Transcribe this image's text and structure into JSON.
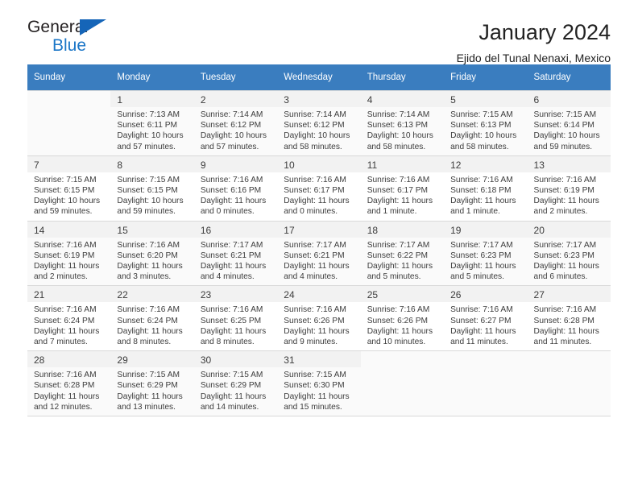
{
  "brand": {
    "name_dark": "General",
    "name_blue": "Blue",
    "accent_color": "#1b76c7",
    "triangle_color": "#1565b8"
  },
  "header": {
    "title": "January 2024",
    "subtitle": "Ejido del Tunal Nenaxi, Mexico"
  },
  "calendar": {
    "header_bg": "#3a7dbf",
    "header_text_color": "#ffffff",
    "weekdays": [
      "Sunday",
      "Monday",
      "Tuesday",
      "Wednesday",
      "Thursday",
      "Friday",
      "Saturday"
    ],
    "weeks": [
      [
        {
          "day": "",
          "lines": []
        },
        {
          "day": "1",
          "lines": [
            "Sunrise: 7:13 AM",
            "Sunset: 6:11 PM",
            "Daylight: 10 hours",
            "and 57 minutes."
          ]
        },
        {
          "day": "2",
          "lines": [
            "Sunrise: 7:14 AM",
            "Sunset: 6:12 PM",
            "Daylight: 10 hours",
            "and 57 minutes."
          ]
        },
        {
          "day": "3",
          "lines": [
            "Sunrise: 7:14 AM",
            "Sunset: 6:12 PM",
            "Daylight: 10 hours",
            "and 58 minutes."
          ]
        },
        {
          "day": "4",
          "lines": [
            "Sunrise: 7:14 AM",
            "Sunset: 6:13 PM",
            "Daylight: 10 hours",
            "and 58 minutes."
          ]
        },
        {
          "day": "5",
          "lines": [
            "Sunrise: 7:15 AM",
            "Sunset: 6:13 PM",
            "Daylight: 10 hours",
            "and 58 minutes."
          ]
        },
        {
          "day": "6",
          "lines": [
            "Sunrise: 7:15 AM",
            "Sunset: 6:14 PM",
            "Daylight: 10 hours",
            "and 59 minutes."
          ]
        }
      ],
      [
        {
          "day": "7",
          "lines": [
            "Sunrise: 7:15 AM",
            "Sunset: 6:15 PM",
            "Daylight: 10 hours",
            "and 59 minutes."
          ]
        },
        {
          "day": "8",
          "lines": [
            "Sunrise: 7:15 AM",
            "Sunset: 6:15 PM",
            "Daylight: 10 hours",
            "and 59 minutes."
          ]
        },
        {
          "day": "9",
          "lines": [
            "Sunrise: 7:16 AM",
            "Sunset: 6:16 PM",
            "Daylight: 11 hours",
            "and 0 minutes."
          ]
        },
        {
          "day": "10",
          "lines": [
            "Sunrise: 7:16 AM",
            "Sunset: 6:17 PM",
            "Daylight: 11 hours",
            "and 0 minutes."
          ]
        },
        {
          "day": "11",
          "lines": [
            "Sunrise: 7:16 AM",
            "Sunset: 6:17 PM",
            "Daylight: 11 hours",
            "and 1 minute."
          ]
        },
        {
          "day": "12",
          "lines": [
            "Sunrise: 7:16 AM",
            "Sunset: 6:18 PM",
            "Daylight: 11 hours",
            "and 1 minute."
          ]
        },
        {
          "day": "13",
          "lines": [
            "Sunrise: 7:16 AM",
            "Sunset: 6:19 PM",
            "Daylight: 11 hours",
            "and 2 minutes."
          ]
        }
      ],
      [
        {
          "day": "14",
          "lines": [
            "Sunrise: 7:16 AM",
            "Sunset: 6:19 PM",
            "Daylight: 11 hours",
            "and 2 minutes."
          ]
        },
        {
          "day": "15",
          "lines": [
            "Sunrise: 7:16 AM",
            "Sunset: 6:20 PM",
            "Daylight: 11 hours",
            "and 3 minutes."
          ]
        },
        {
          "day": "16",
          "lines": [
            "Sunrise: 7:17 AM",
            "Sunset: 6:21 PM",
            "Daylight: 11 hours",
            "and 4 minutes."
          ]
        },
        {
          "day": "17",
          "lines": [
            "Sunrise: 7:17 AM",
            "Sunset: 6:21 PM",
            "Daylight: 11 hours",
            "and 4 minutes."
          ]
        },
        {
          "day": "18",
          "lines": [
            "Sunrise: 7:17 AM",
            "Sunset: 6:22 PM",
            "Daylight: 11 hours",
            "and 5 minutes."
          ]
        },
        {
          "day": "19",
          "lines": [
            "Sunrise: 7:17 AM",
            "Sunset: 6:23 PM",
            "Daylight: 11 hours",
            "and 5 minutes."
          ]
        },
        {
          "day": "20",
          "lines": [
            "Sunrise: 7:17 AM",
            "Sunset: 6:23 PM",
            "Daylight: 11 hours",
            "and 6 minutes."
          ]
        }
      ],
      [
        {
          "day": "21",
          "lines": [
            "Sunrise: 7:16 AM",
            "Sunset: 6:24 PM",
            "Daylight: 11 hours",
            "and 7 minutes."
          ]
        },
        {
          "day": "22",
          "lines": [
            "Sunrise: 7:16 AM",
            "Sunset: 6:24 PM",
            "Daylight: 11 hours",
            "and 8 minutes."
          ]
        },
        {
          "day": "23",
          "lines": [
            "Sunrise: 7:16 AM",
            "Sunset: 6:25 PM",
            "Daylight: 11 hours",
            "and 8 minutes."
          ]
        },
        {
          "day": "24",
          "lines": [
            "Sunrise: 7:16 AM",
            "Sunset: 6:26 PM",
            "Daylight: 11 hours",
            "and 9 minutes."
          ]
        },
        {
          "day": "25",
          "lines": [
            "Sunrise: 7:16 AM",
            "Sunset: 6:26 PM",
            "Daylight: 11 hours",
            "and 10 minutes."
          ]
        },
        {
          "day": "26",
          "lines": [
            "Sunrise: 7:16 AM",
            "Sunset: 6:27 PM",
            "Daylight: 11 hours",
            "and 11 minutes."
          ]
        },
        {
          "day": "27",
          "lines": [
            "Sunrise: 7:16 AM",
            "Sunset: 6:28 PM",
            "Daylight: 11 hours",
            "and 11 minutes."
          ]
        }
      ],
      [
        {
          "day": "28",
          "lines": [
            "Sunrise: 7:16 AM",
            "Sunset: 6:28 PM",
            "Daylight: 11 hours",
            "and 12 minutes."
          ]
        },
        {
          "day": "29",
          "lines": [
            "Sunrise: 7:15 AM",
            "Sunset: 6:29 PM",
            "Daylight: 11 hours",
            "and 13 minutes."
          ]
        },
        {
          "day": "30",
          "lines": [
            "Sunrise: 7:15 AM",
            "Sunset: 6:29 PM",
            "Daylight: 11 hours",
            "and 14 minutes."
          ]
        },
        {
          "day": "31",
          "lines": [
            "Sunrise: 7:15 AM",
            "Sunset: 6:30 PM",
            "Daylight: 11 hours",
            "and 15 minutes."
          ]
        },
        {
          "day": "",
          "lines": []
        },
        {
          "day": "",
          "lines": []
        },
        {
          "day": "",
          "lines": []
        }
      ]
    ]
  }
}
